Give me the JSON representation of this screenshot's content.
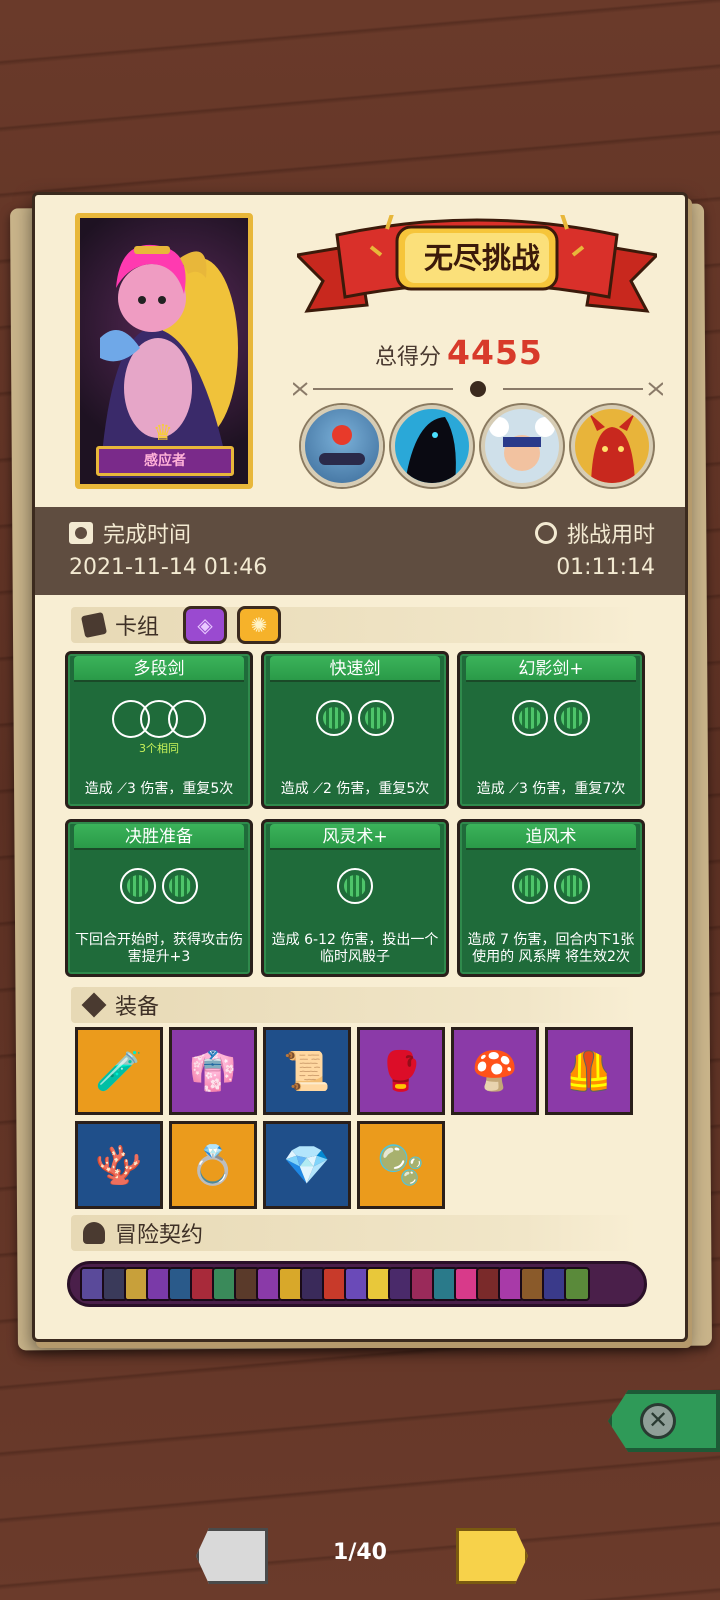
{
  "hero": {
    "name": "感应者"
  },
  "banner": {
    "title": "无尽挑战"
  },
  "score": {
    "label": "总得分",
    "value": "4455"
  },
  "info": {
    "finish_label": "完成时间",
    "finish_value": "2021-11-14 01:46",
    "duration_label": "挑战用时",
    "duration_value": "01:11:14"
  },
  "deck": {
    "title": "卡组",
    "cards": [
      {
        "name": "多段剑",
        "sub": "3个相同",
        "desc": "造成 ⟋3 伤害，重复5次"
      },
      {
        "name": "快速剑",
        "desc": "造成 ⟋2 伤害，重复5次"
      },
      {
        "name": "幻影剑+",
        "desc": "造成 ⟋3 伤害，重复7次"
      },
      {
        "name": "决胜准备",
        "desc": "下回合开始时，获得攻击伤害提升+3"
      },
      {
        "name": "风灵术+",
        "desc": "造成 6-12 伤害，投出一个临时风骰子"
      },
      {
        "name": "追风术",
        "desc": "造成 7 伤害，回合内下1张使用的 风系牌 将生效2次"
      }
    ]
  },
  "equipment": {
    "title": "装备"
  },
  "contracts": {
    "title": "冒险契约"
  },
  "pagination": {
    "indicator": "1/40"
  },
  "colors": {
    "accent": "#d83a2a",
    "card_green": "#1f6b3a",
    "panel": "#f8eed3"
  }
}
